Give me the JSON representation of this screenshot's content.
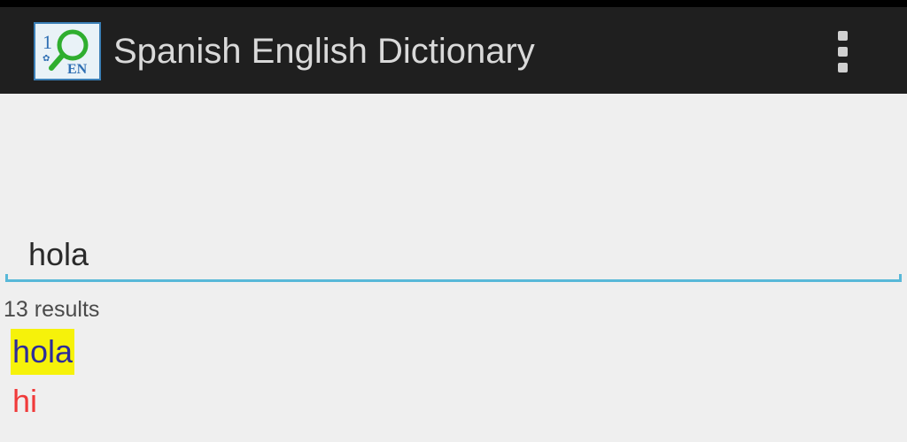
{
  "action_bar": {
    "app_icon": "dictionary-magnifier-icon",
    "title": "Spanish English Dictionary",
    "overflow_icon": "more-vert-icon",
    "background": "#1f1f1f"
  },
  "search": {
    "value": "hola",
    "underline_color": "#58b8d8"
  },
  "results": {
    "count_text": "13 results",
    "items": [
      {
        "word": "hola",
        "translation": "hi"
      }
    ]
  },
  "colors": {
    "word_text": "#2d2c9b",
    "word_highlight": "#f6f20a",
    "translation_text": "#f03a3a"
  }
}
